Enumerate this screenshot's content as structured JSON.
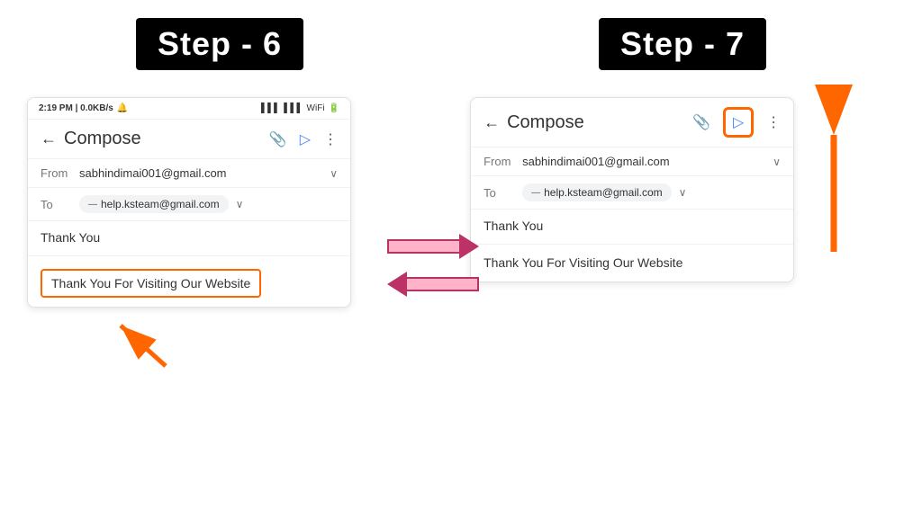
{
  "page": {
    "background": "#ffffff"
  },
  "left": {
    "step_label": "Step - 6",
    "phone": {
      "status_time": "2:19 PM | 0.0KB/s",
      "compose_title": "Compose",
      "from_label": "From",
      "from_email": "sabhindimai001@gmail.com",
      "to_label": "To",
      "to_email": "help.ksteam@gmail.com",
      "subject": "Thank You",
      "body": "Thank You For Visiting Our Website"
    }
  },
  "right": {
    "step_label": "Step - 7",
    "phone": {
      "compose_title": "Compose",
      "from_label": "From",
      "from_email": "sabhindimai001@gmail.com",
      "to_label": "To",
      "to_email": "help.ksteam@gmail.com",
      "subject": "Thank You",
      "body": "Thank You For Visiting Our Website"
    }
  },
  "arrows": {
    "right_arrow_label": "→",
    "left_arrow_label": "←"
  },
  "icons": {
    "attach": "📎",
    "send": "▷",
    "more": "⋮",
    "back": "←",
    "chevron": "∨",
    "dot_dot": "—"
  }
}
